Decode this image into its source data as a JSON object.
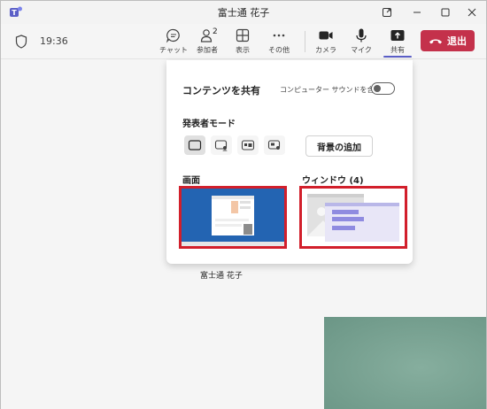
{
  "window": {
    "title": "富士通 花子"
  },
  "toolbar": {
    "timer": "19:36",
    "buttons": [
      {
        "label": "チャット",
        "icon": "chat-icon"
      },
      {
        "label": "参加者",
        "icon": "people-icon",
        "count": "2"
      },
      {
        "label": "表示",
        "icon": "grid-icon"
      },
      {
        "label": "その他",
        "icon": "more-icon"
      },
      {
        "label": "カメラ",
        "icon": "camera-icon"
      },
      {
        "label": "マイク",
        "icon": "mic-icon"
      },
      {
        "label": "共有",
        "icon": "share-icon",
        "active": true
      }
    ],
    "leave_label": "退出"
  },
  "share_panel": {
    "title": "コンテンツを共有",
    "audio_label": "コンピューター サウンドを含む",
    "audio_enabled": false,
    "presenter_mode_title": "発表者モード",
    "presenter_modes": [
      "content-only-icon",
      "standout-icon",
      "side-by-side-icon",
      "reporter-icon"
    ],
    "add_background_label": "背景の追加",
    "screen_section": "画面",
    "window_section": "ウィンドウ (4)"
  },
  "stage": {
    "participant_name": "富士通 花子"
  },
  "colors": {
    "accent": "#5b5fc7",
    "leave": "#c4314b",
    "highlight": "#d21f2b",
    "screen_bg": "#1f5fae"
  }
}
